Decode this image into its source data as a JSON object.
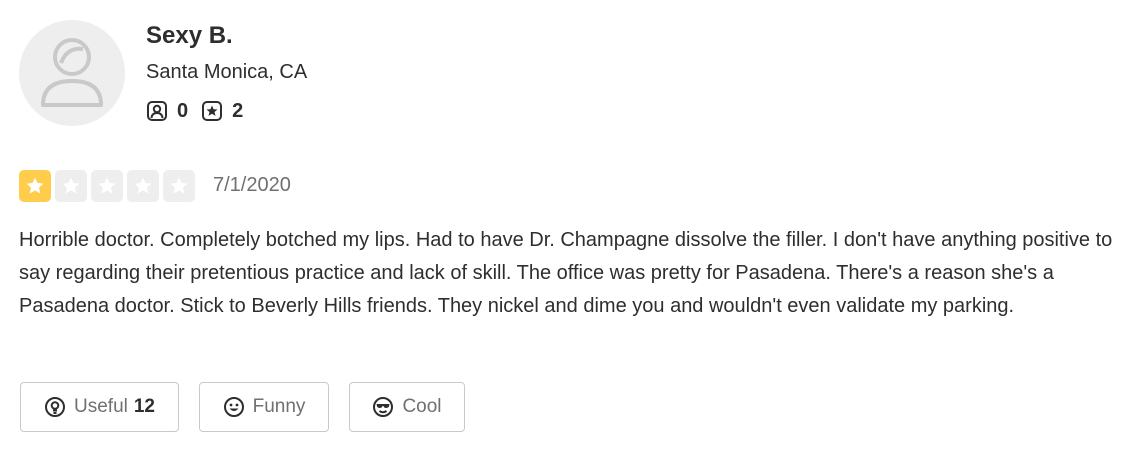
{
  "user": {
    "name": "Sexy B.",
    "location": "Santa Monica, CA",
    "friends_count": "0",
    "reviews_count": "2"
  },
  "review": {
    "rating": 1,
    "rating_max": 5,
    "date": "7/1/2020",
    "text": "Horrible doctor. Completely botched my lips. Had to have Dr. Champagne dissolve the filler. I don't have anything positive to say regarding their pretentious practice and lack of skill. The office was pretty for Pasadena. There's a reason she's a Pasadena doctor. Stick to Beverly Hills friends. They nickel and dime you and wouldn't even validate my parking."
  },
  "actions": {
    "useful_label": "Useful",
    "useful_count": "12",
    "funny_label": "Funny",
    "cool_label": "Cool"
  },
  "icons": {
    "avatar": "default-user-avatar-icon",
    "friends": "friends-icon",
    "reviews": "review-star-icon",
    "useful": "lightbulb-icon",
    "funny": "smiley-icon",
    "cool": "sunglasses-icon"
  },
  "colors": {
    "star_filled": "#ffcc4b",
    "star_empty": "#eeeeef",
    "text": "#2d2e2f",
    "muted": "#6e7072"
  }
}
